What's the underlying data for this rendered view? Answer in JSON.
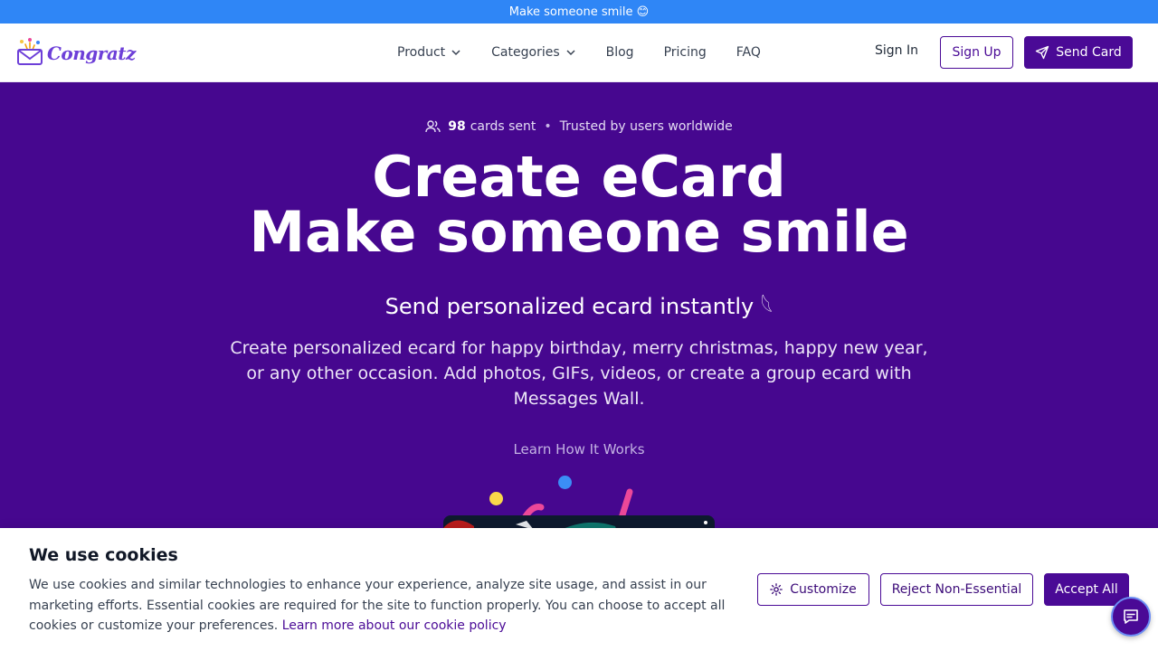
{
  "announcement": "Make someone smile 😊",
  "brand": {
    "name": "Congratz",
    "accent": "#4a0a96",
    "logo_color": "#6d3fd8"
  },
  "nav": {
    "links": [
      {
        "label": "Product",
        "dropdown": true
      },
      {
        "label": "Categories",
        "dropdown": true
      },
      {
        "label": "Blog",
        "dropdown": false
      },
      {
        "label": "Pricing",
        "dropdown": false
      },
      {
        "label": "FAQ",
        "dropdown": false
      }
    ],
    "sign_in": "Sign In",
    "sign_up": "Sign Up",
    "send_card": "Send Card"
  },
  "hero": {
    "count": "98",
    "count_suffix": "cards sent",
    "trusted": "Trusted by users worldwide",
    "title_line1": "Create eCard",
    "title_line2": "Make someone smile",
    "subtitle": "Send personalized ecard instantly 𓆩",
    "description": "Create personalized ecard for happy birthday, merry christmas, happy new year, or any other occasion. Add photos, GIFs, videos, or create a group ecard with Messages Wall.",
    "learn_link": "Learn How It Works",
    "background": "#46078f"
  },
  "cookie": {
    "title": "We use cookies",
    "text": "We use cookies and similar technologies to enhance your experience, analyze site usage, and assist in our marketing efforts. Essential cookies are required for the site to function properly. You can choose to accept all cookies or customize your preferences.",
    "policy_link": "Learn more about our cookie policy",
    "customize": "Customize",
    "reject": "Reject Non-Essential",
    "accept": "Accept All"
  },
  "icons": {
    "logo": "envelope-confetti-icon",
    "chevron": "chevron-down-icon",
    "send": "paper-plane-icon",
    "users": "users-icon",
    "settings": "gear-icon",
    "chat": "chat-bubble-icon"
  }
}
